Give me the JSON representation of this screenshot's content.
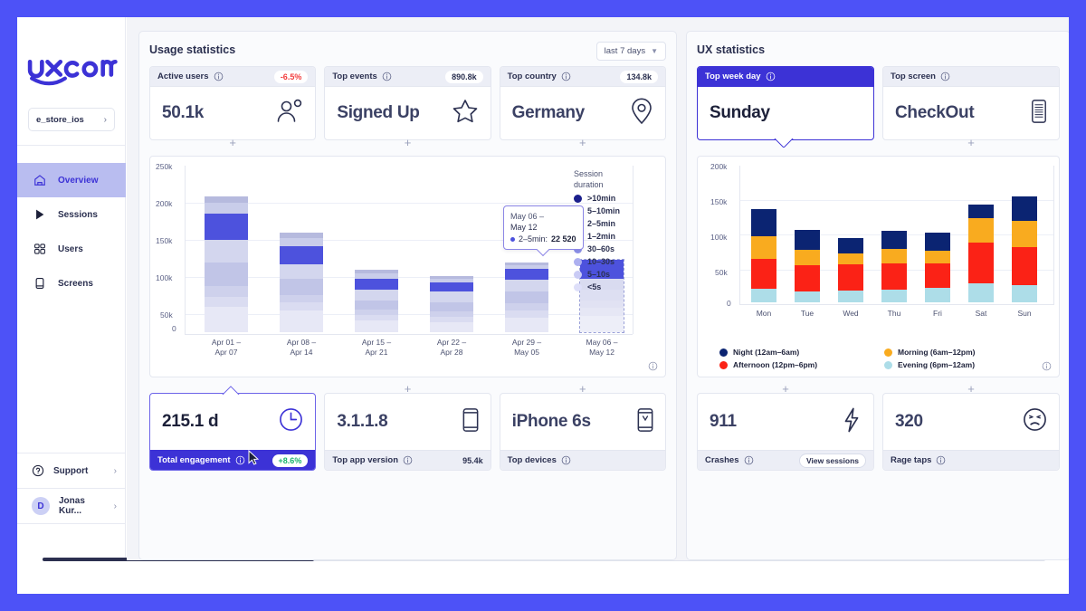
{
  "brand": {
    "logo_text": "uxcam",
    "accent": "#3c32d6"
  },
  "sidebar": {
    "project": {
      "label": "e_store_ios",
      "chevron": "chevron-right-icon"
    },
    "items": [
      {
        "label": "Overview",
        "icon": "home-icon",
        "active": true
      },
      {
        "label": "Sessions",
        "icon": "play-icon",
        "active": false
      },
      {
        "label": "Users",
        "icon": "users-grid-icon",
        "active": false
      },
      {
        "label": "Screens",
        "icon": "screen-icon",
        "active": false
      }
    ],
    "support": {
      "label": "Support",
      "icon": "question-circle-icon",
      "arrow": "›"
    },
    "account": {
      "label": "Jonas Kur...",
      "initial": "D",
      "arrow": "›"
    }
  },
  "usage": {
    "title": "Usage statistics",
    "range": {
      "label": "last 7 days",
      "chevron": "chevron-down-icon"
    },
    "kpis": [
      {
        "name": "Active users",
        "badge": "-6.5%",
        "badge_kind": "red",
        "value": "50.1k",
        "icon": "user-badge-icon"
      },
      {
        "name": "Top events",
        "badge": "890.8k",
        "badge_kind": "plain",
        "value": "Signed Up",
        "icon": "star-icon"
      },
      {
        "name": "Top country",
        "badge": "134.8k",
        "badge_kind": "plain",
        "value": "Germany",
        "icon": "map-pin-icon"
      }
    ],
    "bottom_cards": [
      {
        "value": "215.1 d",
        "label": "Total engagement",
        "badge": "+8.6%",
        "badge_kind": "green",
        "icon": "clock-icon",
        "selected": true
      },
      {
        "value": "3.1.1.8",
        "label": "Top app version",
        "badge": "95.4k",
        "badge_kind": "count",
        "icon": "phone-icon",
        "selected": false
      },
      {
        "value": "iPhone 6s",
        "label": "Top devices",
        "badge": "",
        "badge_kind": "none",
        "icon": "phone-v-icon",
        "selected": false
      }
    ],
    "tooltip": {
      "line1": "May 06 –",
      "line2": "May 12",
      "series": "2–5min:",
      "value": "22 520"
    },
    "legend_title_l1": "Session",
    "legend_title_l2": "duration",
    "plus_label": "+"
  },
  "ux": {
    "title": "UX statistics",
    "kpis": [
      {
        "name": "Top week day",
        "value": "Sunday",
        "icon": "none",
        "highlight": true
      },
      {
        "name": "Top screen",
        "value": "CheckOut",
        "icon": "screen-list-icon",
        "highlight": false
      }
    ],
    "bottom_cards": [
      {
        "value": "911",
        "label": "Crashes",
        "action": "View sessions",
        "icon": "bolt-icon"
      },
      {
        "value": "320",
        "label": "Rage taps",
        "action": "",
        "icon": "angry-face-icon"
      }
    ]
  },
  "chart_data": [
    {
      "type": "bar",
      "id": "session-duration-weekly",
      "title": "Session duration",
      "stacked": true,
      "xlabel": "",
      "ylabel": "",
      "ylim": [
        0,
        250000
      ],
      "yticks": [
        "0",
        "50k",
        "100k",
        "150k",
        "200k",
        "250k"
      ],
      "ytick_values": [
        0,
        50000,
        100000,
        150000,
        200000,
        250000
      ],
      "grid": true,
      "legend_position": "right",
      "legend_title": "Session duration",
      "categories": [
        "Apr 01 – Apr 07",
        "Apr 08 – Apr 14",
        "Apr 15 – Apr 21",
        "Apr 22 – Apr 28",
        "Apr 29 – May 05",
        "May 06 – May 12"
      ],
      "totals": [
        203000,
        148000,
        93000,
        84000,
        104000,
        108000
      ],
      "series": [
        {
          "name": "<5s",
          "color": "#e7e8f6",
          "values": [
            38000,
            33000,
            17000,
            14000,
            22000,
            25000
          ]
        },
        {
          "name": "5–10s",
          "color": "#dadcf1",
          "values": [
            15000,
            12000,
            8000,
            8000,
            11000,
            12000
          ]
        },
        {
          "name": "10–30s",
          "color": "#ced1ec",
          "values": [
            16000,
            11000,
            8000,
            8000,
            11000,
            11000
          ]
        },
        {
          "name": "30–60s",
          "color": "#c1c5e7",
          "values": [
            35000,
            24000,
            14000,
            13000,
            17000,
            17000
          ]
        },
        {
          "name": "1–2min",
          "color": "#b1b6e1",
          "values": [
            34000,
            21000,
            17000,
            17000,
            17000,
            17000
          ]
        },
        {
          "name": "2–5min",
          "color": "#4d52dd",
          "values": [
            39000,
            27000,
            16000,
            14000,
            16000,
            22520
          ]
        },
        {
          "name": "5–10min",
          "color": "#c9cdea",
          "values": [
            17000,
            12000,
            8000,
            6000,
            7000,
            2000
          ]
        },
        {
          "name": ">10min",
          "color": "#b6bade",
          "values": [
            9000,
            8000,
            5000,
            4000,
            3000,
            1500
          ]
        }
      ],
      "legend_entries": [
        {
          "label": ">10min",
          "color": "#1b1f8c"
        },
        {
          "label": "5–10min",
          "color": "#2c32c0"
        },
        {
          "label": "2–5min",
          "color": "#4348da"
        },
        {
          "label": "1–2min",
          "color": "#6a6fe4"
        },
        {
          "label": "30–60s",
          "color": "#8e92ea"
        },
        {
          "label": "10–30s",
          "color": "#adb0f0"
        },
        {
          "label": "5–10s",
          "color": "#c9cbf5"
        },
        {
          "label": "<5s",
          "color": "#dedff9"
        }
      ]
    },
    {
      "type": "bar",
      "id": "sessions-by-weekday-daypart",
      "title": "",
      "stacked": true,
      "xlabel": "",
      "ylabel": "",
      "ylim": [
        0,
        200000
      ],
      "yticks": [
        "0",
        "50k",
        "100k",
        "150k",
        "200k"
      ],
      "ytick_values": [
        0,
        50000,
        100000,
        150000,
        200000
      ],
      "grid": true,
      "legend_position": "bottom",
      "categories": [
        "Mon",
        "Tue",
        "Wed",
        "Thu",
        "Fri",
        "Sat",
        "Sun"
      ],
      "totals": [
        135000,
        104000,
        93000,
        103000,
        101000,
        141000,
        153000
      ],
      "series": [
        {
          "name": "Evening (6pm–12am)",
          "color": "#addde8",
          "values": [
            20000,
            16000,
            17000,
            19000,
            21000,
            28000,
            25000
          ]
        },
        {
          "name": "Afternoon (12pm–6pm)",
          "color": "#fb2216",
          "values": [
            43000,
            38000,
            38000,
            37000,
            35000,
            58000,
            55000
          ]
        },
        {
          "name": "Morning (6am–12pm)",
          "color": "#f9ab1f",
          "values": [
            32000,
            22000,
            16000,
            21000,
            19000,
            35000,
            38000
          ]
        },
        {
          "name": "Night (12am–6am)",
          "color": "#0b2472",
          "values": [
            40000,
            28000,
            22000,
            26000,
            26000,
            20000,
            35000
          ]
        }
      ],
      "legend_entries": [
        {
          "label": "Night (12am–6am)",
          "color": "#0b2472"
        },
        {
          "label": "Morning (6am–12pm)",
          "color": "#f9ab1f"
        },
        {
          "label": "Afternoon (12pm–6pm)",
          "color": "#fb2216"
        },
        {
          "label": "Evening (6pm–12am)",
          "color": "#addde8"
        }
      ]
    }
  ]
}
